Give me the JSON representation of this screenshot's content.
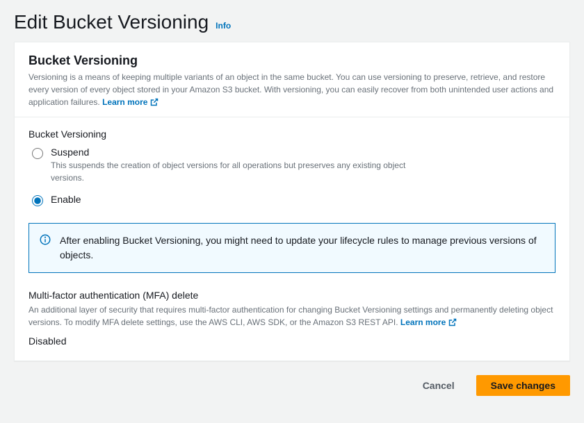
{
  "page": {
    "title": "Edit Bucket Versioning",
    "info_label": "Info"
  },
  "panel": {
    "title": "Bucket Versioning",
    "description": "Versioning is a means of keeping multiple variants of an object in the same bucket. You can use versioning to preserve, retrieve, and restore every version of every object stored in your Amazon S3 bucket. With versioning, you can easily recover from both unintended user actions and application failures.",
    "learn_more": "Learn more"
  },
  "versioning": {
    "label": "Bucket Versioning",
    "selected": "enable",
    "options": {
      "suspend": {
        "label": "Suspend",
        "description": "This suspends the creation of object versions for all operations but preserves any existing object versions."
      },
      "enable": {
        "label": "Enable"
      }
    }
  },
  "alert": {
    "text": "After enabling Bucket Versioning, you might need to update your lifecycle rules to manage previous versions of objects."
  },
  "mfa": {
    "title": "Multi-factor authentication (MFA) delete",
    "description": "An additional layer of security that requires multi-factor authentication for changing Bucket Versioning settings and permanently deleting object versions. To modify MFA delete settings, use the AWS CLI, AWS SDK, or the Amazon S3 REST API.",
    "learn_more": "Learn more",
    "value": "Disabled"
  },
  "footer": {
    "cancel": "Cancel",
    "save": "Save changes"
  }
}
